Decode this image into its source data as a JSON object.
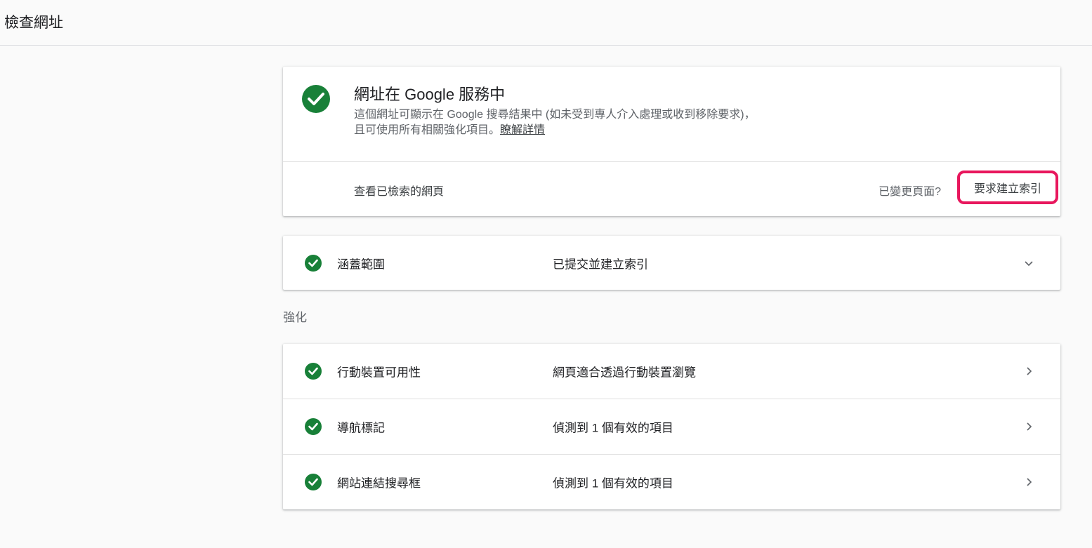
{
  "header": {
    "title": "檢查網址"
  },
  "status": {
    "heading": "網址在 Google 服務中",
    "description_line1": "這個網址可顯示在 Google 搜尋結果中 (如未受到專人介入處理或收到移除要求)，",
    "description_line2": "且可使用所有相關強化項目。",
    "learn_more": "瞭解詳情",
    "view_crawled_page": "查看已檢索的網頁",
    "changed_question": "已變更頁面?",
    "request_indexing": "要求建立索引",
    "icon": "check-circle-icon",
    "accent_color": "#188038",
    "highlight_color": "#e8175d"
  },
  "coverage": {
    "label": "涵蓋範圍",
    "value": "已提交並建立索引",
    "icon": "chevron-down-icon"
  },
  "enhancements": {
    "section_label": "強化",
    "rows": [
      {
        "label": "行動裝置可用性",
        "value": "網頁適合透過行動裝置瀏覽"
      },
      {
        "label": "導航標記",
        "value": "偵測到 1 個有效的項目"
      },
      {
        "label": "網站連結搜尋框",
        "value": "偵測到 1 個有效的項目"
      }
    ]
  }
}
